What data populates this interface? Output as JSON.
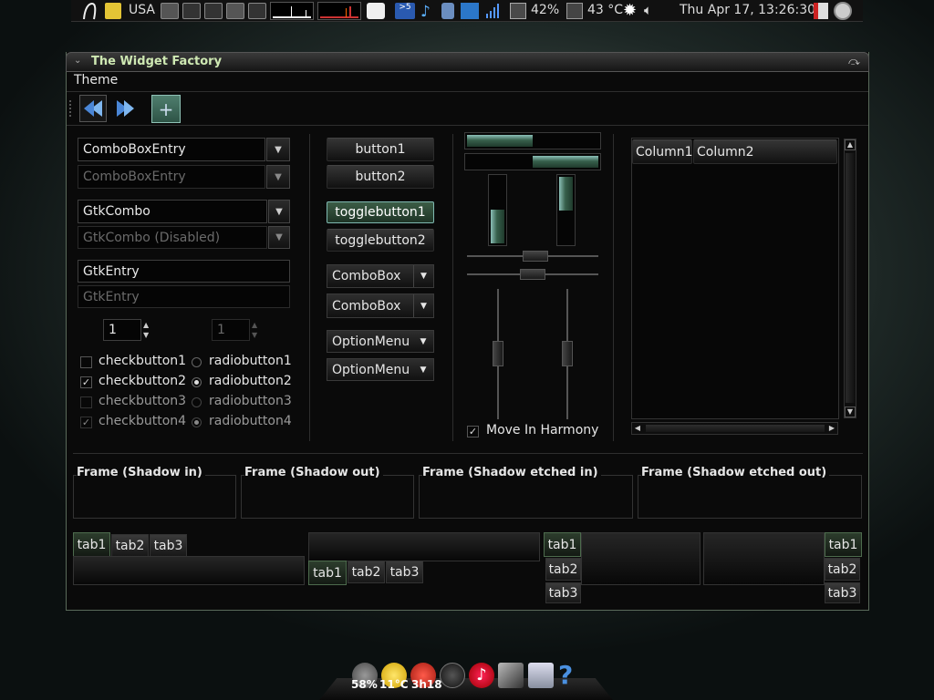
{
  "panel": {
    "keyboard_layout": "USA",
    "battery": "42%",
    "temperature": "43 °C",
    "clock": "Thu Apr 17, 13:26:30",
    "icons": [
      "foot-menu-icon",
      "note-icon",
      "drive-icon",
      "network-icon",
      "cpu-graph-icon",
      "memory-graph-icon",
      "switch-user-icon",
      "weather-icon",
      "music-icon",
      "clipboard-icon",
      "terminal-icon",
      "signal-icon",
      "battery-icon",
      "sun-icon",
      "volume-icon",
      "logout-icon",
      "power-icon"
    ]
  },
  "window": {
    "title": "The Widget Factory",
    "menu": {
      "theme": "Theme"
    },
    "toolbar": {
      "back": "back-icon",
      "forward": "forward-icon",
      "add": "add-icon"
    }
  },
  "left": {
    "combo_entry_1": "ComboBoxEntry",
    "combo_entry_2": "ComboBoxEntry",
    "gtk_combo_1": "GtkCombo",
    "gtk_combo_2": "GtkCombo (Disabled)",
    "entry_1": "GtkEntry",
    "entry_2": "GtkEntry",
    "spin_1": "1",
    "spin_2": "1",
    "checks": [
      {
        "label": "checkbutton1",
        "checked": false,
        "disabled": false
      },
      {
        "label": "checkbutton2",
        "checked": true,
        "disabled": false
      },
      {
        "label": "checkbutton3",
        "checked": false,
        "disabled": true
      },
      {
        "label": "checkbutton4",
        "checked": true,
        "disabled": true
      }
    ],
    "radios": [
      {
        "label": "radiobutton1",
        "selected": false
      },
      {
        "label": "radiobutton2",
        "selected": true
      },
      {
        "label": "radiobutton3",
        "selected": false
      },
      {
        "label": "radiobutton4",
        "selected": true
      }
    ]
  },
  "middle": {
    "button1": "button1",
    "button2": "button2",
    "toggle1": "togglebutton1",
    "toggle2": "togglebutton2",
    "combobox1": "ComboBox",
    "combobox2": "ComboBox",
    "option1": "OptionMenu",
    "option2": "OptionMenu"
  },
  "ranges": {
    "move_in_harmony": "Move In Harmony",
    "progress_h1": 0.5,
    "progress_h2": 0.5,
    "progress_v1": 0.5,
    "progress_v2": 0.5
  },
  "tree": {
    "col1": "Column1",
    "col2": "Column2"
  },
  "frames": [
    "Frame (Shadow in)",
    "Frame (Shadow out)",
    "Frame (Shadow etched in)",
    "Frame (Shadow etched out)"
  ],
  "notebooks": {
    "tabs": [
      "tab1",
      "tab2",
      "tab3"
    ]
  },
  "dock": {
    "disk": "58%",
    "weather": "11°C",
    "timer": "3h18"
  }
}
